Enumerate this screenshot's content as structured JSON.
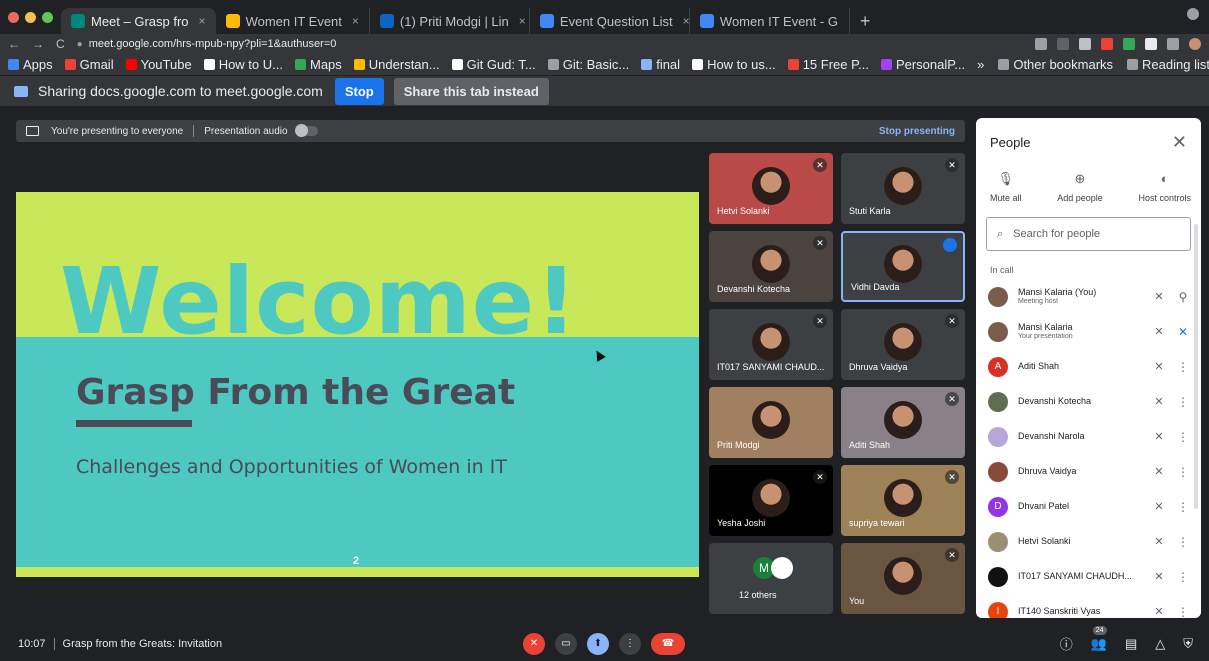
{
  "browser": {
    "tabs": [
      {
        "label": "Meet – Grasp fro",
        "active": true,
        "color": "#00897b"
      },
      {
        "label": "Women IT Event",
        "active": false,
        "color": "#fbbc04"
      },
      {
        "label": "(1) Priti Modgi | Lin",
        "active": false,
        "color": "#0a66c2"
      },
      {
        "label": "Event Question List",
        "active": false,
        "color": "#4285f4"
      },
      {
        "label": "Women IT Event - G",
        "active": false,
        "color": "#4285f4"
      }
    ],
    "new_tab": "+",
    "url": "meet.google.com/hrs-mpub-npy?pli=1&authuser=0",
    "bookmarks": [
      {
        "label": "Apps",
        "color": "#4285f4"
      },
      {
        "label": "Gmail",
        "color": "#ea4335"
      },
      {
        "label": "YouTube",
        "color": "#ff0000"
      },
      {
        "label": "How to U...",
        "color": "#ffffff"
      },
      {
        "label": "Maps",
        "color": "#34a853"
      },
      {
        "label": "Understan...",
        "color": "#fbbc04"
      },
      {
        "label": "Git Gud: T...",
        "color": "#ffffff"
      },
      {
        "label": "Git: Basic...",
        "color": "#9aa0a6"
      },
      {
        "label": "final",
        "color": "#8ab4f8"
      },
      {
        "label": "How to us...",
        "color": "#ffffff"
      },
      {
        "label": "15 Free P...",
        "color": "#ea4335"
      },
      {
        "label": "PersonalP...",
        "color": "#a142f4"
      }
    ],
    "more": "»",
    "other_bookmarks": "Other bookmarks",
    "reading_list": "Reading list"
  },
  "share_bar": {
    "message": "Sharing docs.google.com to meet.google.com",
    "stop": "Stop",
    "share_tab": "Share this tab instead"
  },
  "presenting": {
    "message": "You're presenting to everyone",
    "audio": "Presentation audio",
    "stop": "Stop presenting"
  },
  "slide": {
    "welcome": "Welcome!",
    "title": "Grasp From the Great",
    "subtitle": "Challenges and Opportunities of Women in IT",
    "page": "2"
  },
  "tiles": [
    {
      "name": "Hetvi Solanki",
      "bg": "#b94a48",
      "muted": true
    },
    {
      "name": "Stuti Karla",
      "bg": "#3c4043",
      "muted": true
    },
    {
      "name": "Devanshi Kotecha",
      "bg": "#4a4340",
      "muted": true
    },
    {
      "name": "Vidhi Davda",
      "bg": "#3c4043",
      "muted": false
    },
    {
      "name": "IT017 SANYAMI CHAUD...",
      "bg": "#3c4043",
      "muted": true
    },
    {
      "name": "Dhruva Vaidya",
      "bg": "#3c4043",
      "muted": true
    },
    {
      "name": "Priti Modgi",
      "bg": "#a08060",
      "muted": false
    },
    {
      "name": "Aditi Shah",
      "bg": "#8a8088",
      "muted": true
    },
    {
      "name": "Yesha Joshi",
      "bg": "#000000",
      "muted": true
    },
    {
      "name": "supriya tewari",
      "bg": "#9c8256",
      "muted": true
    },
    {
      "name": "12 others",
      "bg": "#3c4043",
      "muted": false
    },
    {
      "name": "You",
      "bg": "#6a5540",
      "muted": true
    }
  ],
  "others_initial": "M",
  "people_panel": {
    "title": "People",
    "mute_all": "Mute all",
    "add_people": "Add people",
    "host_controls": "Host controls",
    "search_placeholder": "Search for people",
    "in_call": "In call",
    "participants": [
      {
        "name": "Mansi Kalaria (You)",
        "sub": "Meeting host",
        "initial": "",
        "color": "#7a5c4a"
      },
      {
        "name": "Mansi Kalaria",
        "sub": "Your presentation",
        "initial": "",
        "color": "#7a5c4a"
      },
      {
        "name": "Aditi Shah",
        "sub": "",
        "initial": "A",
        "color": "#d93025"
      },
      {
        "name": "Devanshi Kotecha",
        "sub": "",
        "initial": "",
        "color": "#5f6d52"
      },
      {
        "name": "Devanshi Narola",
        "sub": "",
        "initial": "",
        "color": "#b7a6d8"
      },
      {
        "name": "Dhruva Vaidya",
        "sub": "",
        "initial": "",
        "color": "#8a4a3a"
      },
      {
        "name": "Dhvani Patel",
        "sub": "",
        "initial": "D",
        "color": "#9334e6"
      },
      {
        "name": "Hetvi Solanki",
        "sub": "",
        "initial": "",
        "color": "#9a8f72"
      },
      {
        "name": "IT017 SANYAMI CHAUDH...",
        "sub": "",
        "initial": "",
        "color": "#111111"
      },
      {
        "name": "IT140 Sanskriti Vyas",
        "sub": "",
        "initial": "I",
        "color": "#e8430a"
      }
    ]
  },
  "bottom": {
    "time": "10:07",
    "meeting": "Grasp from the Greats: Invitation",
    "participant_count": "24"
  }
}
